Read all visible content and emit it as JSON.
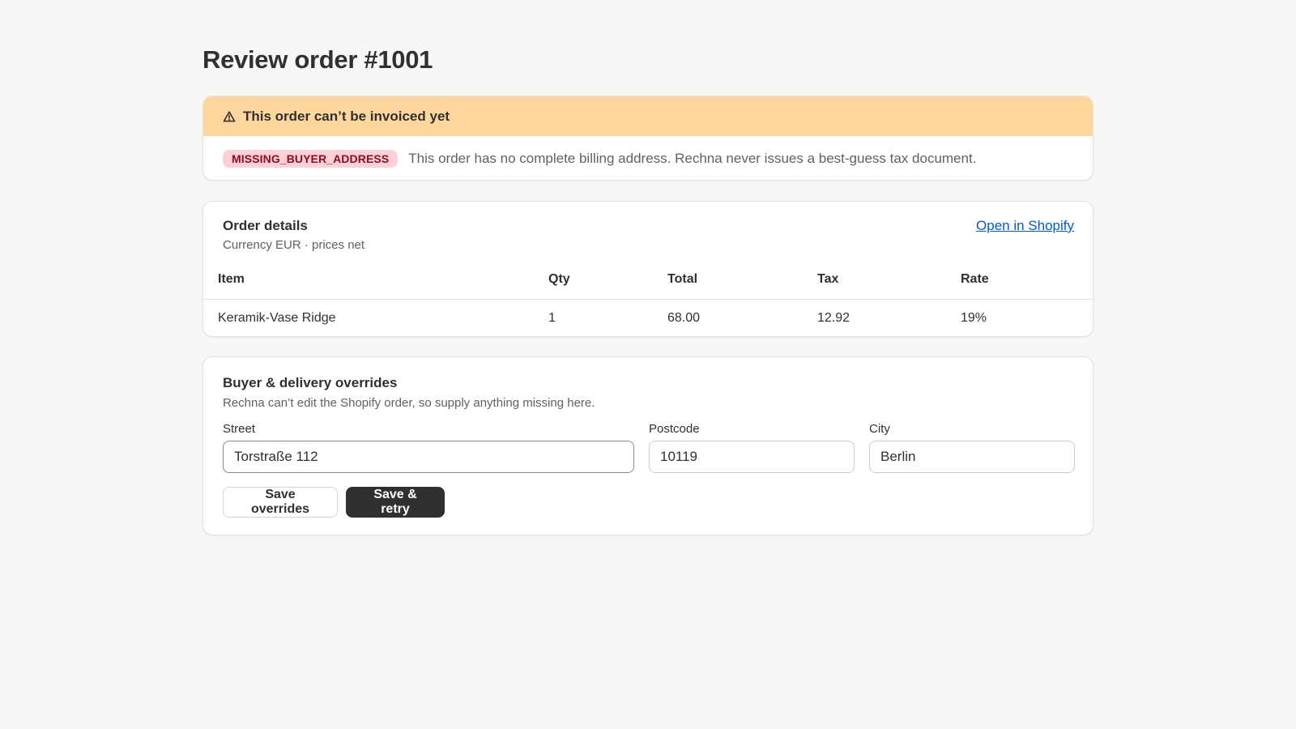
{
  "page": {
    "title": "Review order #1001"
  },
  "banner": {
    "title": "This order can’t be invoiced yet",
    "icon": "warning-triangle-icon",
    "code": "MISSING_BUYER_ADDRESS",
    "message": "This order has no complete billing address. Rechna never issues a best-guess tax document.",
    "colors": {
      "header_bg": "#ffd79d",
      "badge_bg": "#fed1d7",
      "badge_text": "#8e0b21"
    }
  },
  "order_details": {
    "title": "Order details",
    "subtitle": "Currency EUR · prices net",
    "link_label": "Open in Shopify",
    "columns": [
      "Item",
      "Qty",
      "Total",
      "Tax",
      "Rate"
    ],
    "rows": [
      {
        "item": "Keramik-Vase Ridge",
        "qty": "1",
        "total": "68.00",
        "tax": "12.92",
        "rate": "19%"
      }
    ]
  },
  "overrides": {
    "title": "Buyer & delivery overrides",
    "subtitle": "Rechna can’t edit the Shopify order, so supply anything missing here.",
    "street": {
      "label": "Street",
      "value": "Torstraße 112"
    },
    "postcode": {
      "label": "Postcode",
      "value": "10119"
    },
    "city": {
      "label": "City",
      "value": "Berlin"
    },
    "save_label": "Save overrides",
    "retry_label": "Save & retry"
  },
  "colors": {
    "link": "#005bd3",
    "primary_button": "#303030"
  }
}
